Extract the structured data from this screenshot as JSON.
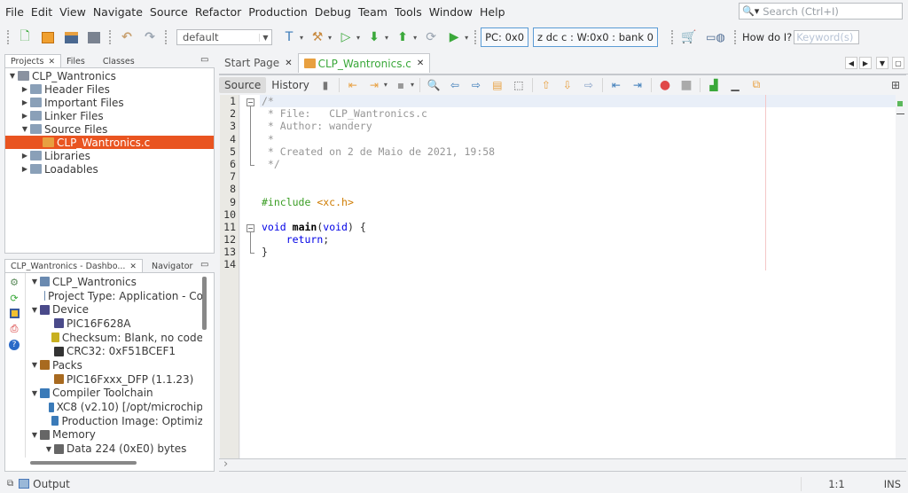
{
  "menu": [
    "File",
    "Edit",
    "View",
    "Navigate",
    "Source",
    "Refactor",
    "Production",
    "Debug",
    "Team",
    "Tools",
    "Window",
    "Help"
  ],
  "search": {
    "placeholder": "Search (Ctrl+I)"
  },
  "toolbar": {
    "config_value": "default",
    "pc_register": "PC: 0x0",
    "status_register": "z dc c  : W:0x0 : bank 0",
    "howdoi_label": "How do I?",
    "keyword_placeholder": "Keyword(s)"
  },
  "projects_panel": {
    "tabs": [
      "Projects",
      "Files",
      "Classes"
    ],
    "tree": [
      {
        "label": "CLP_Wantronics",
        "level": 0,
        "expanded": true,
        "icon": "project-icon"
      },
      {
        "label": "Header Files",
        "level": 1,
        "expanded": false,
        "icon": "folder-icon"
      },
      {
        "label": "Important Files",
        "level": 1,
        "expanded": false,
        "icon": "folder-icon"
      },
      {
        "label": "Linker Files",
        "level": 1,
        "expanded": false,
        "icon": "folder-icon"
      },
      {
        "label": "Source Files",
        "level": 1,
        "expanded": true,
        "icon": "folder-icon"
      },
      {
        "label": "CLP_Wantronics.c",
        "level": 2,
        "selected": true,
        "icon": "c-file-icon"
      },
      {
        "label": "Libraries",
        "level": 1,
        "expanded": false,
        "icon": "folder-icon"
      },
      {
        "label": "Loadables",
        "level": 1,
        "expanded": false,
        "icon": "folder-icon"
      }
    ]
  },
  "dashboard_panel": {
    "tabs": [
      "CLP_Wantronics - Dashbo...",
      "Navigator"
    ],
    "tree": [
      {
        "label": "CLP_Wantronics",
        "level": 0,
        "expanded": true
      },
      {
        "label": "Project Type: Application - Co",
        "level": 1
      },
      {
        "label": "Device",
        "level": 0,
        "expanded": true
      },
      {
        "label": "PIC16F628A",
        "level": 1
      },
      {
        "label": "Checksum: Blank, no code",
        "level": 1
      },
      {
        "label": "CRC32: 0xF51BCEF1",
        "level": 1
      },
      {
        "label": "Packs",
        "level": 0,
        "expanded": true
      },
      {
        "label": "PIC16Fxxx_DFP (1.1.23)",
        "level": 1
      },
      {
        "label": "Compiler Toolchain",
        "level": 0,
        "expanded": true
      },
      {
        "label": "XC8 (v2.10) [/opt/microchip",
        "level": 1
      },
      {
        "label": "Production Image: Optimiz",
        "level": 1
      },
      {
        "label": "Memory",
        "level": 0,
        "expanded": true
      },
      {
        "label": "Data 224 (0xE0) bytes",
        "level": 1,
        "expanded": true
      }
    ]
  },
  "editor": {
    "tabs": [
      {
        "label": "Start Page",
        "active": false
      },
      {
        "label": "CLP_Wantronics.c",
        "active": true
      }
    ],
    "view_tabs": [
      "Source",
      "History"
    ],
    "lines": [
      "/*",
      " * File:   CLP_Wantronics.c",
      " * Author: wandery",
      " *",
      " * Created on 2 de Maio de 2021, 19:58",
      " */",
      "",
      "",
      "#include <xc.h>",
      "",
      "void main(void) {",
      "    return;",
      "}",
      ""
    ]
  },
  "status": {
    "output_label": "Output",
    "position": "1:1",
    "mode": "INS"
  }
}
